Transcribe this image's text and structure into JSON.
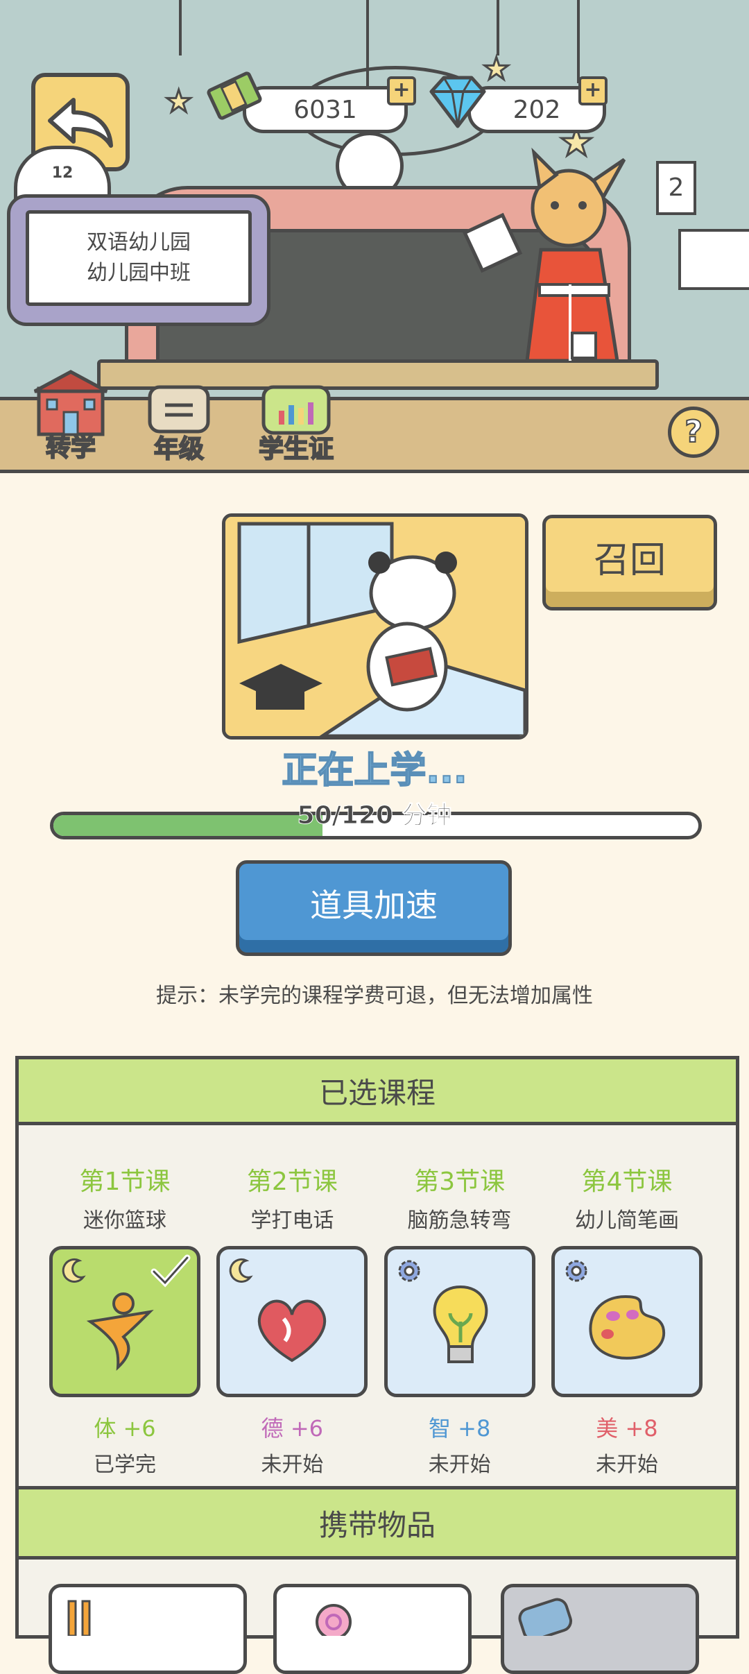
{
  "currency": {
    "coins": "6031",
    "gems": "202"
  },
  "header": {
    "grade_badge": "12"
  },
  "school_sign": {
    "line1": "双语幼儿园",
    "line2": "幼儿园中班"
  },
  "toolbar": {
    "transfer": "转学",
    "grade": "年级",
    "student_id": "学生证",
    "help": "?"
  },
  "poster_number": "2",
  "status": {
    "recall_label": "召回",
    "studying_text": "正在上学...",
    "progress_text": "50/120 分钟",
    "progress_value": 50,
    "progress_max": 120
  },
  "speed_up_label": "道具加速",
  "tip": "提示：未学完的课程学费可退，但无法增加属性",
  "courses_section": {
    "title": "已选课程",
    "courses": [
      {
        "title": "第1节课",
        "name": "迷你篮球",
        "attr": "体 +6",
        "status": "已学完",
        "bg": "#b9dc6d",
        "attr_color": "#8cc63f",
        "icon": "runner-icon"
      },
      {
        "title": "第2节课",
        "name": "学打电话",
        "attr": "德 +6",
        "status": "未开始",
        "bg": "#dcebf8",
        "attr_color": "#c069b8",
        "icon": "heart-icon"
      },
      {
        "title": "第3节课",
        "name": "脑筋急转弯",
        "attr": "智 +8",
        "status": "未开始",
        "bg": "#dcebf8",
        "attr_color": "#4f97d3",
        "icon": "lightbulb-icon"
      },
      {
        "title": "第4节课",
        "name": "幼儿简笔画",
        "attr": "美 +8",
        "status": "未开始",
        "bg": "#dcebf8",
        "attr_color": "#e0606a",
        "icon": "palette-icon"
      }
    ]
  },
  "carry_section": {
    "title": "携带物品"
  }
}
